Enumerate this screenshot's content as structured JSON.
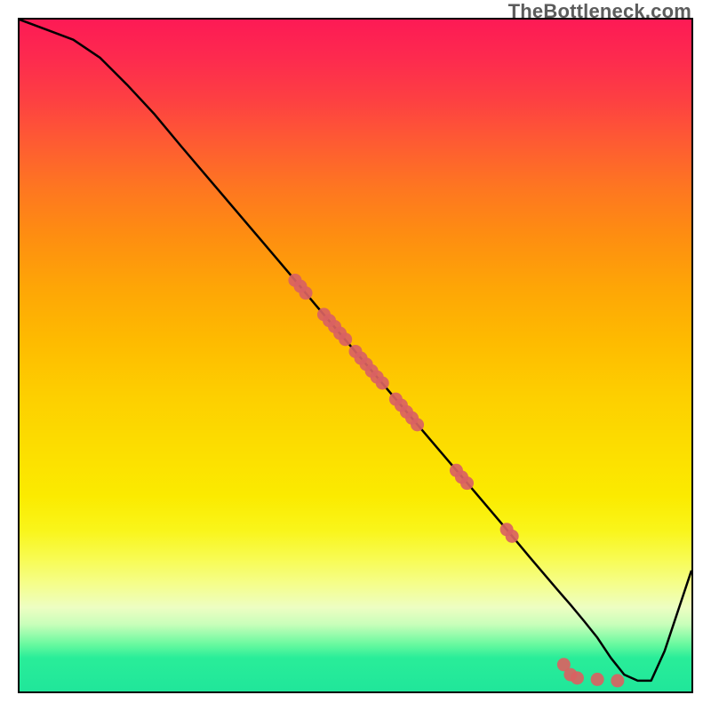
{
  "watermark": {
    "text": "TheBottleneck.com"
  },
  "chart_data": {
    "type": "line",
    "title": "",
    "xlabel": "",
    "ylabel": "",
    "xlim": [
      0,
      100
    ],
    "ylim": [
      0,
      100
    ],
    "grid": false,
    "legend": false,
    "series": [
      {
        "name": "curve",
        "x": [
          0,
          4,
          8,
          12,
          16,
          20,
          24,
          28,
          32,
          36,
          40,
          44,
          48,
          52,
          56,
          60,
          64,
          68,
          72,
          76,
          80,
          82,
          84,
          86,
          88,
          90,
          92,
          94,
          96,
          98,
          100
        ],
        "y": [
          100,
          98.5,
          97,
          94.3,
          90.3,
          86.0,
          81.2,
          76.5,
          71.8,
          67.1,
          62.4,
          57.6,
          52.9,
          48.2,
          43.5,
          38.8,
          34.1,
          29.4,
          24.7,
          19.9,
          15.2,
          12.9,
          10.5,
          8.0,
          5.0,
          2.5,
          1.6,
          1.6,
          6.0,
          12.0,
          18.0
        ],
        "color": "#000000"
      }
    ],
    "scatter": [
      {
        "name": "dots",
        "color": "#d96262",
        "points": [
          {
            "x": 41.0,
            "y": 61.2
          },
          {
            "x": 41.8,
            "y": 60.3
          },
          {
            "x": 42.6,
            "y": 59.3
          },
          {
            "x": 45.3,
            "y": 56.1
          },
          {
            "x": 46.1,
            "y": 55.2
          },
          {
            "x": 46.9,
            "y": 54.3
          },
          {
            "x": 47.7,
            "y": 53.3
          },
          {
            "x": 48.5,
            "y": 52.4
          },
          {
            "x": 50.0,
            "y": 50.6
          },
          {
            "x": 50.8,
            "y": 49.6
          },
          {
            "x": 51.6,
            "y": 48.7
          },
          {
            "x": 52.4,
            "y": 47.7
          },
          {
            "x": 53.2,
            "y": 46.8
          },
          {
            "x": 54.0,
            "y": 45.9
          },
          {
            "x": 56.0,
            "y": 43.5
          },
          {
            "x": 56.8,
            "y": 42.6
          },
          {
            "x": 57.6,
            "y": 41.6
          },
          {
            "x": 58.4,
            "y": 40.7
          },
          {
            "x": 59.2,
            "y": 39.7
          },
          {
            "x": 65.0,
            "y": 32.9
          },
          {
            "x": 65.8,
            "y": 31.9
          },
          {
            "x": 66.6,
            "y": 31.0
          },
          {
            "x": 72.5,
            "y": 24.1
          },
          {
            "x": 73.3,
            "y": 23.1
          },
          {
            "x": 81.0,
            "y": 4.0
          },
          {
            "x": 82.0,
            "y": 2.5
          },
          {
            "x": 83.0,
            "y": 2.0
          },
          {
            "x": 86.0,
            "y": 1.8
          },
          {
            "x": 89.0,
            "y": 1.6
          }
        ]
      }
    ]
  }
}
